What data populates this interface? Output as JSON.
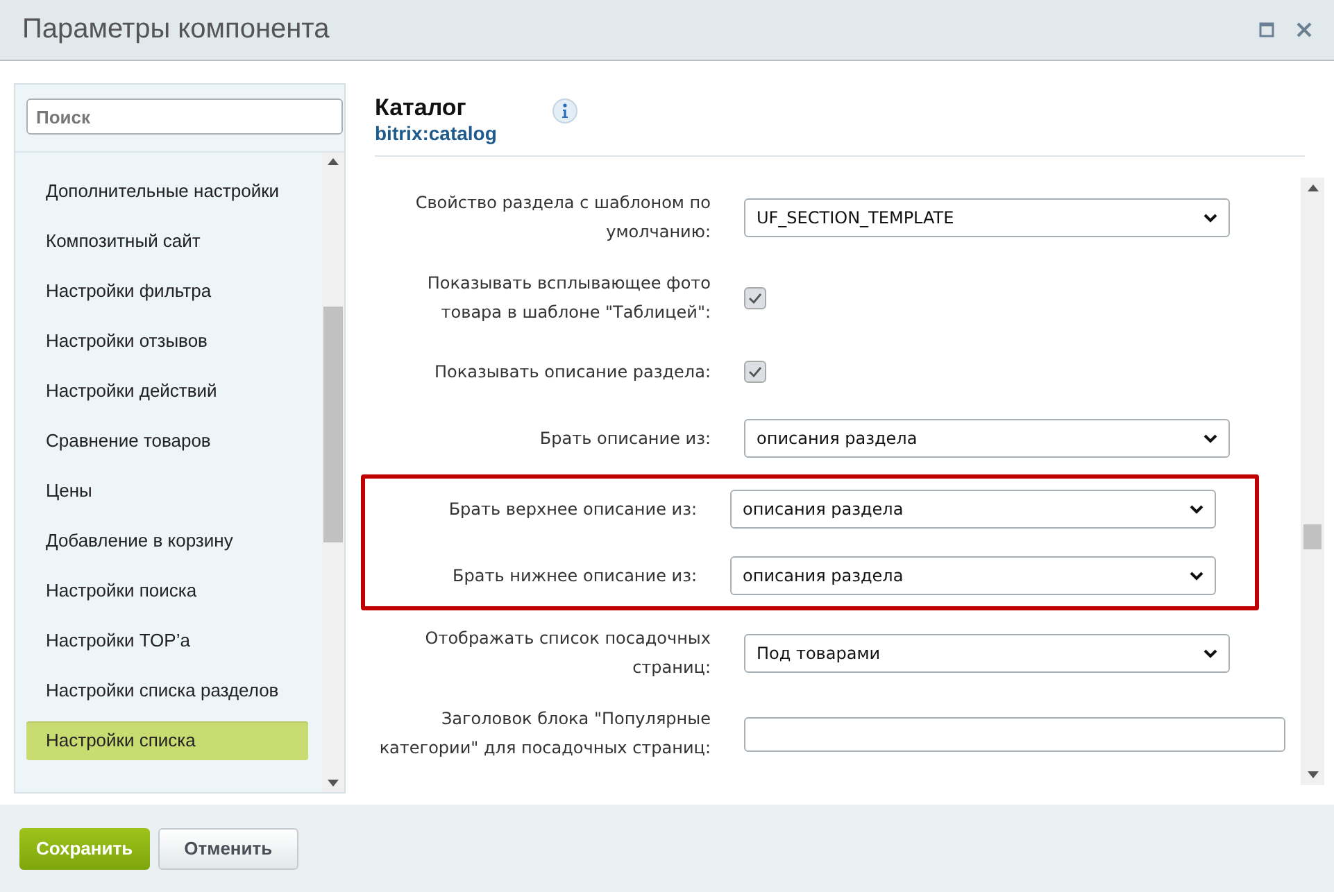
{
  "window": {
    "title": "Параметры компонента"
  },
  "sidebar": {
    "search": {
      "placeholder": "Поиск"
    },
    "items": [
      {
        "label": "Дополнительные настройки",
        "selected": false
      },
      {
        "label": "Композитный сайт",
        "selected": false
      },
      {
        "label": "Настройки фильтра",
        "selected": false
      },
      {
        "label": "Настройки отзывов",
        "selected": false
      },
      {
        "label": "Настройки действий",
        "selected": false
      },
      {
        "label": "Сравнение товаров",
        "selected": false
      },
      {
        "label": "Цены",
        "selected": false
      },
      {
        "label": "Добавление в корзину",
        "selected": false
      },
      {
        "label": "Настройки поиска",
        "selected": false
      },
      {
        "label": "Настройки TOP’а",
        "selected": false
      },
      {
        "label": "Настройки списка разделов",
        "selected": false
      },
      {
        "label": "Настройки списка",
        "selected": true
      }
    ]
  },
  "component": {
    "title": "Каталог",
    "code": "bitrix:catalog"
  },
  "form": {
    "rows": [
      {
        "kind": "select",
        "label": "Свойство раздела с шаблоном по умолчанию:",
        "value": "UF_SECTION_TEMPLATE"
      },
      {
        "kind": "checkbox",
        "label": "Показывать всплывающее фото товара в шаблоне \"Таблицей\":",
        "checked": true
      },
      {
        "kind": "checkbox",
        "label": "Показывать описание раздела:",
        "checked": true
      },
      {
        "kind": "select",
        "label": "Брать описание из:",
        "value": "описания раздела"
      },
      {
        "kind": "highlight",
        "rows": [
          {
            "kind": "select",
            "label": "Брать верхнее описание из:",
            "value": "описания раздела"
          },
          {
            "kind": "select",
            "label": "Брать нижнее описание из:",
            "value": "описания раздела"
          }
        ]
      },
      {
        "kind": "select",
        "label": "Отображать список посадочных страниц:",
        "value": "Под товарами"
      },
      {
        "kind": "text",
        "label": "Заголовок блока \"Популярные категории\" для посадочных страниц:",
        "value": ""
      }
    ]
  },
  "buttons": [
    {
      "kind": "primary",
      "label": "Сохранить"
    },
    {
      "kind": "secondary",
      "label": "Отменить"
    }
  ]
}
